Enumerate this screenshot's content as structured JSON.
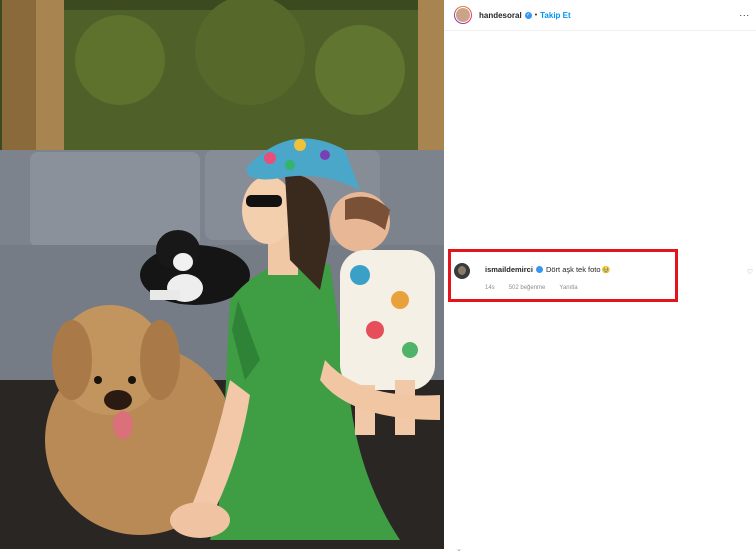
{
  "post": {
    "username": "handesoral",
    "follow_label": "Takip Et",
    "separator": "•",
    "more_label": "..."
  },
  "comment": {
    "username": "ismaildemirci",
    "text": "Dört aşk tek foto",
    "emoji": "🥹",
    "time": "14s",
    "likes": "502 beğenme",
    "reply_label": "Yanıtla"
  },
  "icons": {
    "verified": "verified-badge-icon",
    "heart": "heart-icon",
    "more": "more-icon",
    "chevron": "chevron-down-icon"
  },
  "colors": {
    "highlight": "#e3141b",
    "follow": "#0095f6",
    "verified": "#3897f0"
  }
}
